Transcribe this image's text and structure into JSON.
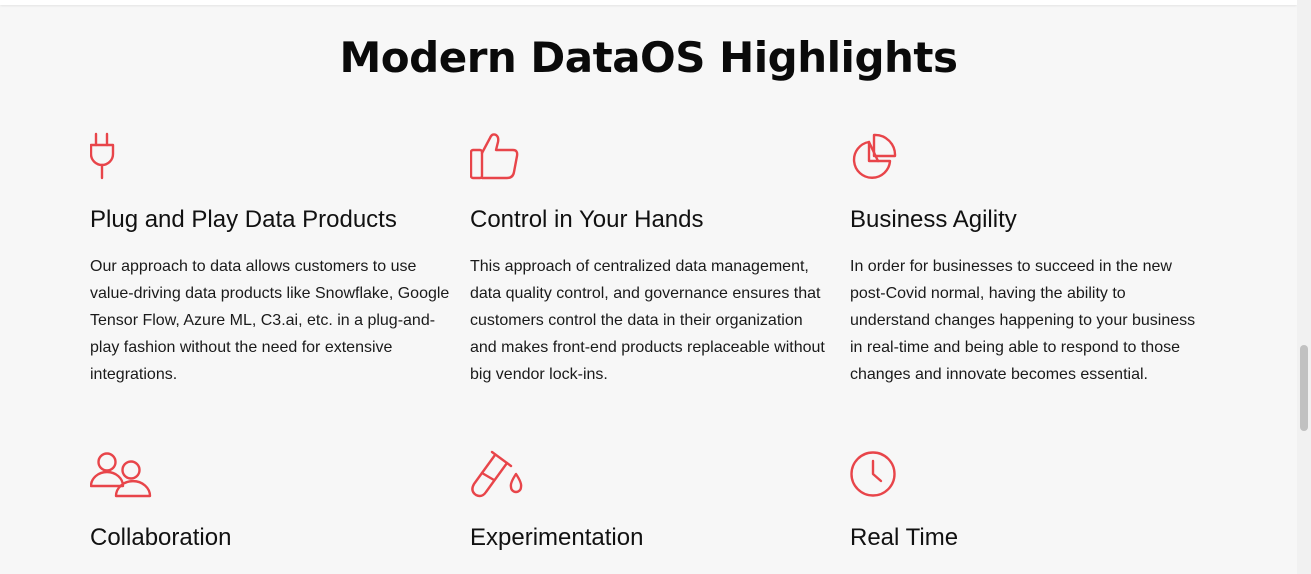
{
  "section": {
    "title": "Modern DataOS Highlights"
  },
  "accent_color": "#e8454a",
  "features": [
    {
      "icon": "plug-icon",
      "title": "Plug and Play Data Products",
      "description": "Our approach to data allows customers to use value-driving data products like Snowflake, Google Tensor Flow, Azure ML, C3.ai, etc. in a plug-and-play fashion without the need for extensive integrations."
    },
    {
      "icon": "thumbs-up-icon",
      "title": "Control in Your Hands",
      "description": "This approach of centralized data management, data quality control, and governance ensures that customers control the data in their organization and makes front-end products replaceable without big vendor lock-ins."
    },
    {
      "icon": "pie-chart-icon",
      "title": "Business Agility",
      "description": "In order for businesses to succeed in the new post-Covid normal, having the ability to understand changes happening to your business in real-time and being able to respond to those changes and innovate becomes essential."
    },
    {
      "icon": "users-icon",
      "title": "Collaboration"
    },
    {
      "icon": "test-tube-icon",
      "title": "Experimentation"
    },
    {
      "icon": "clock-icon",
      "title": "Real Time"
    }
  ]
}
